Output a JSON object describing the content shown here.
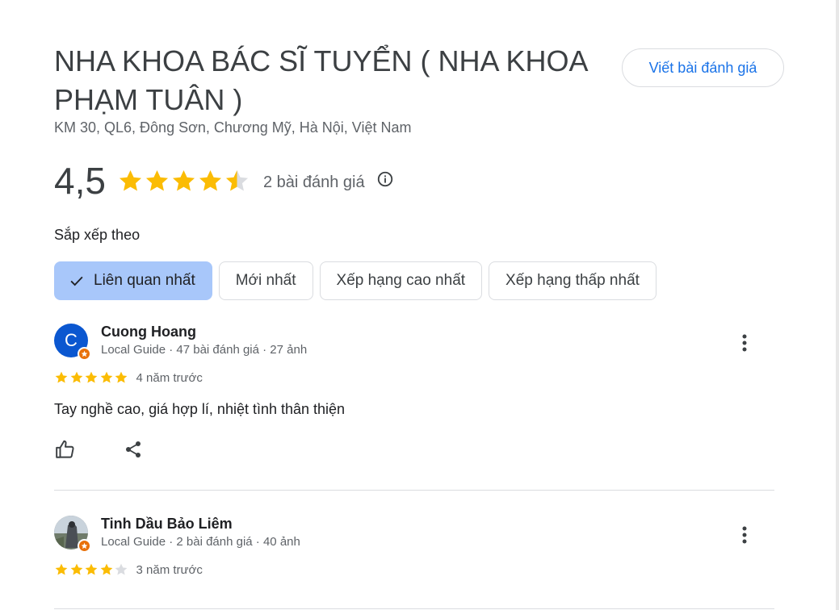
{
  "place": {
    "title": "NHA KHOA BÁC SĨ TUYỂN ( NHA KHOA PHẠM TUÂN )",
    "address": "KM 30, QL6, Đông Sơn, Chương Mỹ, Hà Nội, Việt Nam",
    "write_review_label": "Viết bài đánh giá"
  },
  "rating": {
    "value": "4,5",
    "stars": 4.5,
    "count_label": "2 bài đánh giá",
    "info_icon": "info-icon"
  },
  "sort": {
    "label": "Sắp xếp theo",
    "options": [
      "Liên quan nhất",
      "Mới nhất",
      "Xếp hạng cao nhất",
      "Xếp hạng thấp nhất"
    ],
    "selected": "Liên quan nhất"
  },
  "reviews": [
    {
      "avatar_letter": "C",
      "avatar_color": "#0b57d0",
      "name": "Cuong Hoang",
      "meta": "Local Guide · 47 bài đánh giá · 27 ảnh",
      "stars": 5,
      "time": "4 năm trước",
      "text": "Tay nghề cao, giá hợp lí, nhiệt tình thân thiện"
    },
    {
      "avatar_letter": "",
      "avatar_color": "#8a9096",
      "name": "Tinh Dầu Bảo Liêm",
      "meta": "Local Guide · 2 bài đánh giá · 40 ảnh",
      "stars": 4,
      "time": "3 năm trước",
      "text": ""
    }
  ],
  "colors": {
    "star": "#fbbc04",
    "star_empty": "#dadce0",
    "accent": "#1a73e8",
    "chip_selected": "#a8c7fa",
    "local_guide_badge": "#e8710a"
  }
}
